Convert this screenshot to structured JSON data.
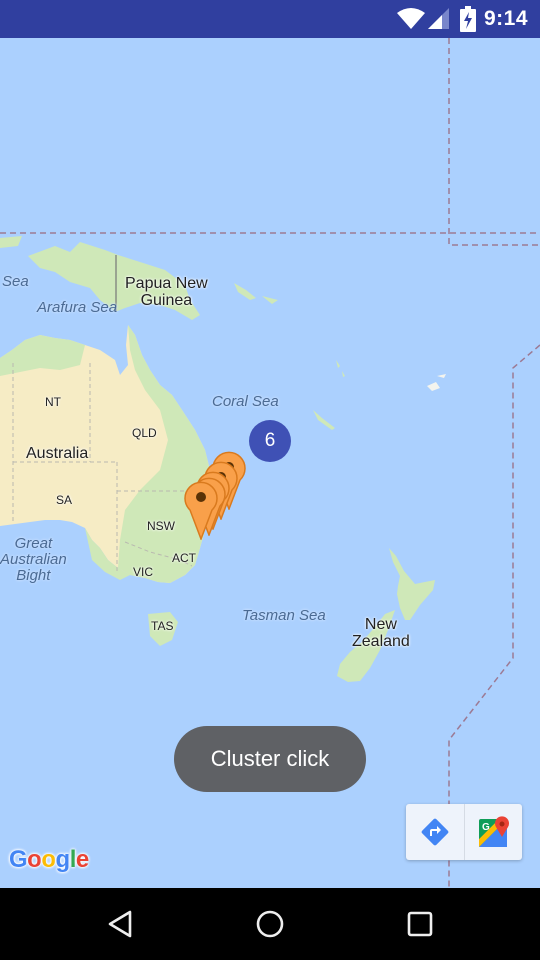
{
  "status_bar": {
    "time": "9:14",
    "icons": [
      "wifi-icon",
      "cell-signal-icon",
      "battery-charging-icon"
    ],
    "background": "#303f9f"
  },
  "map": {
    "water_color": "#abd0fe",
    "land_color": "#cfe8b8",
    "desert_color": "#f6ecc5",
    "labels": {
      "sea_partial": "Sea",
      "arafura_sea": "Arafura Sea",
      "papua_new_guinea": "Papua New\nGuinea",
      "coral_sea": "Coral Sea",
      "australia": "Australia",
      "nt": "NT",
      "qld": "QLD",
      "sa": "SA",
      "nsw": "NSW",
      "act": "ACT",
      "vic": "VIC",
      "tas": "TAS",
      "great_australian_bight": "Great\nAustralian\nBight",
      "tasman_sea": "Tasman Sea",
      "new_zealand": "New\nZealand"
    },
    "cluster": {
      "count": "6",
      "color": "#3f51b5"
    },
    "markers": {
      "count": 5,
      "color": "#f9a04a",
      "icon": "map-pin-icon"
    }
  },
  "toast": {
    "text": "Cluster click"
  },
  "map_toolbar": {
    "directions_icon": "directions-icon",
    "google_maps_icon": "google-maps-icon"
  },
  "google_logo": {
    "letters": [
      "G",
      "o",
      "o",
      "g",
      "l",
      "e"
    ],
    "colors": [
      "#4285f4",
      "#ea4335",
      "#fbbc05",
      "#4285f4",
      "#34a853",
      "#ea4335"
    ]
  },
  "nav_bar": {
    "buttons": [
      "back",
      "home",
      "recents"
    ]
  }
}
